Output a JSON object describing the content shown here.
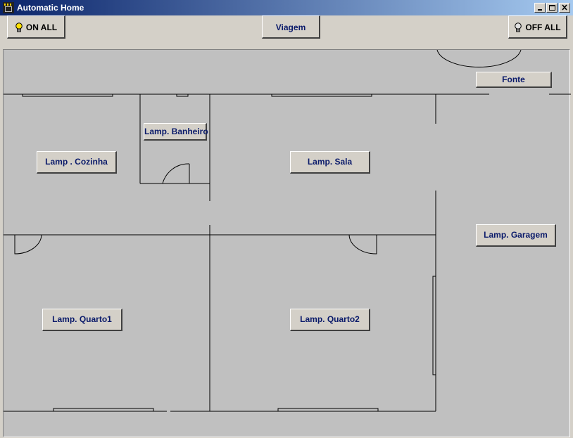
{
  "window": {
    "title": "Automatic Home"
  },
  "toolbar": {
    "on_all": "ON ALL",
    "viagem": "Viagem",
    "off_all": "OFF ALL"
  },
  "lamps": {
    "fonte": "Fonte",
    "banheiro": "Lamp. Banheiro",
    "cozinha": "Lamp . Cozinha",
    "sala": "Lamp. Sala",
    "garagem": "Lamp. Garagem",
    "quarto1": "Lamp. Quarto1",
    "quarto2": "Lamp. Quarto2"
  },
  "icons": {
    "on_bulb": "lightbulb-on-icon",
    "off_bulb": "lightbulb-off-icon",
    "app": "app-icon"
  },
  "colors": {
    "label": "#0a1a6a",
    "bulb_on": "#ffe000",
    "titlebar": "#0a246a"
  }
}
